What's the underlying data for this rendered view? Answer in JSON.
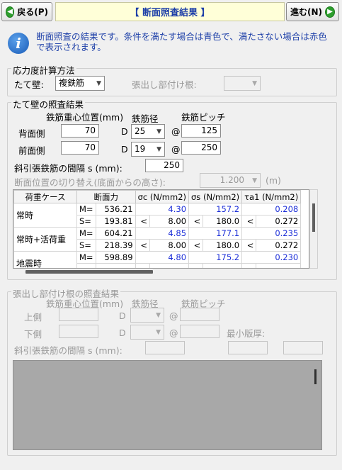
{
  "toolbar": {
    "back_label": "戻る(P)",
    "back_icon": "arrow-left-circle",
    "title": "【 断面照査結果 】",
    "next_label": "進む(N)",
    "next_icon": "arrow-right-circle"
  },
  "info": {
    "icon": "info",
    "text": "断面照査の結果です。条件を満たす場合は青色で、満たさない場合は赤色で表示されます。"
  },
  "stress_method": {
    "title": "応力度計算方法",
    "wall_label": "たて壁:",
    "wall_value": "複鉄筋",
    "cantilever_label": "張出し部付け根:",
    "cantilever_value": ""
  },
  "wall_result": {
    "title": "たて壁の照査結果",
    "col_position": "鉄筋重心位置(mm)",
    "col_diameter": "鉄筋径",
    "col_pitch": "鉄筋ピッチ",
    "back": {
      "label": "背面側",
      "position": "70",
      "d_prefix": "D",
      "diameter": "25",
      "at": "@",
      "pitch": "125"
    },
    "front": {
      "label": "前面側",
      "position": "70",
      "d_prefix": "D",
      "diameter": "19",
      "at": "@",
      "pitch": "250"
    },
    "stirrup_label": "斜引張鉄筋の間隔 s (mm):",
    "stirrup_value": "250",
    "switch_label": "断面位置の切り替え(底面からの高さ):",
    "switch_value": "1.200",
    "switch_unit": "(m)"
  },
  "table": {
    "headers": [
      "荷重ケース",
      "断面力",
      "σc (N/mm2)",
      "σs (N/mm2)",
      "τa1 (N/mm2)"
    ],
    "rows": [
      {
        "case": "常時",
        "m_label": "M=",
        "m_value": "536.21",
        "s_label": "S=",
        "s_value": "193.81",
        "sc_m": "4.30",
        "sc_s_sym": "<",
        "sc_s": "8.00",
        "ss_m": "157.2",
        "ss_s_sym": "<",
        "ss_s": "180.0",
        "ta_m": "0.208",
        "ta_s_sym": "<",
        "ta_s": "0.272"
      },
      {
        "case": "常時+活荷重",
        "m_label": "M=",
        "m_value": "604.21",
        "s_label": "S=",
        "s_value": "218.39",
        "sc_m": "4.85",
        "sc_s_sym": "<",
        "sc_s": "8.00",
        "ss_m": "177.1",
        "ss_s_sym": "<",
        "ss_s": "180.0",
        "ta_m": "0.235",
        "ta_s_sym": "<",
        "ta_s": "0.272"
      },
      {
        "case": "地震時",
        "m_label": "M=",
        "m_value": "598.89",
        "s_label": "",
        "s_value": "",
        "sc_m": "4.80",
        "sc_s_sym": "",
        "sc_s": "",
        "ss_m": "175.2",
        "ss_s_sym": "",
        "ss_s": "",
        "ta_m": "0.230",
        "ta_s_sym": "",
        "ta_s": ""
      }
    ]
  },
  "cantilever_result": {
    "title": "張出し部付け根の照査結果",
    "col_position": "鉄筋重心位置(mm)",
    "col_diameter": "鉄筋径",
    "col_pitch": "鉄筋ピッチ",
    "upper_label": "上側",
    "lower_label": "下側",
    "d_prefix": "D",
    "at": "@",
    "min_thickness_label": "最小版厚:",
    "stirrup_label": "斜引張鉄筋の間隔 s (mm):"
  },
  "colors": {
    "title_text": "#1d3fa8",
    "ok_value": "#1d2fd8",
    "title_bg": "#ffffd8"
  }
}
